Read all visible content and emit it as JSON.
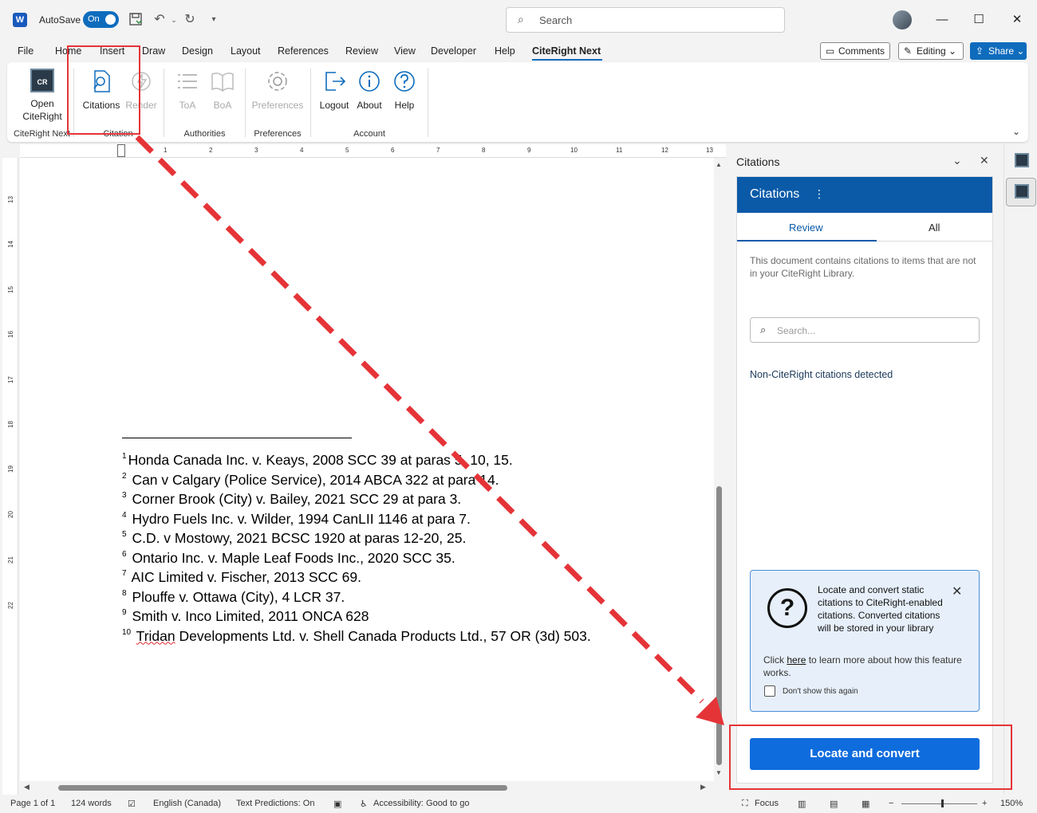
{
  "titlebar": {
    "app_letter": "W",
    "autosave_label": "AutoSave",
    "autosave_state": "On",
    "search_placeholder": "Search"
  },
  "ribbon_tabs": [
    "File",
    "Home",
    "Insert",
    "Draw",
    "Design",
    "Layout",
    "References",
    "Review",
    "View",
    "Developer",
    "Help",
    "CiteRight Next"
  ],
  "active_tab": "CiteRight Next",
  "ribbon_buttons": {
    "comments": "Comments",
    "editing": "Editing",
    "share": "Share"
  },
  "ribbon": {
    "open_citeright": "Open CiteRight",
    "logo_text": "CR",
    "citations": "Citations",
    "render": "Render",
    "toa": "ToA",
    "boa": "BoA",
    "preferences": "Preferences",
    "logout": "Logout",
    "about": "About",
    "help": "Help",
    "groups": {
      "citeright_next": "CiteRight Next",
      "citation": "Citation",
      "authorities": "Authorities",
      "preferences": "Preferences",
      "account": "Account"
    }
  },
  "ruler": {
    "horizontal": [
      "1",
      "2",
      "3",
      "4",
      "5",
      "6",
      "7",
      "8",
      "9",
      "10",
      "11",
      "12",
      "13"
    ],
    "vertical": [
      "13",
      "14",
      "15",
      "16",
      "17",
      "18",
      "19",
      "20",
      "21",
      "22"
    ]
  },
  "footnotes": [
    {
      "num": "1",
      "text": "Honda Canada Inc. v. Keays, 2008 SCC 39 at paras 5, 10, 15."
    },
    {
      "num": "2",
      "text": "Can v Calgary (Police Service), 2014 ABCA 322 at para 14."
    },
    {
      "num": "3",
      "text": "Corner Brook (City) v. Bailey, 2021 SCC 29 at para 3."
    },
    {
      "num": "4",
      "text": "Hydro Fuels Inc. v. Wilder, 1994 CanLII 1146 at para 7."
    },
    {
      "num": "5",
      "text": "C.D. v Mostowy, 2021 BCSC 1920 at paras 12-20, 25."
    },
    {
      "num": "6",
      "text": "Ontario Inc. v. Maple Leaf Foods Inc., 2020 SCC 35."
    },
    {
      "num": "7",
      "text": "AIC Limited v. Fischer, 2013 SCC 69."
    },
    {
      "num": "8",
      "text": "Plouffe v. Ottawa (City), 4 LCR 37."
    },
    {
      "num": "9",
      "text": "Smith v. Inco Limited, 2011 ONCA 628"
    },
    {
      "num": "10",
      "squiggle": "Tridan",
      "text": " Developments Ltd. v. Shell Canada Products Ltd., 57 OR (3d) 503."
    }
  ],
  "pane": {
    "title": "Citations",
    "header": "Citations",
    "header_menu": "⋮",
    "tab_review": "Review",
    "tab_all": "All",
    "message": "This document contains citations to items that are not in your CiteRight Library.",
    "search_placeholder": "Search...",
    "detected": "Non-CiteRight citations detected",
    "info": {
      "text": "Locate and convert static citations to CiteRight-enabled citations. Converted citations will be stored in your library",
      "click_prefix": "Click ",
      "click_link": "here",
      "click_suffix": " to learn more about how this feature works.",
      "checkbox_label": "Don't show this again"
    },
    "button": "Locate and convert"
  },
  "statusbar": {
    "page": "Page 1 of 1",
    "words": "124 words",
    "language": "English (Canada)",
    "predictions": "Text Predictions: On",
    "accessibility": "Accessibility: Good to go",
    "focus": "Focus",
    "zoom": "150%",
    "zoom_minus": "−",
    "zoom_plus": "+"
  },
  "colors": {
    "accent": "#0f6cbd",
    "annotation": "#e53438",
    "pane_header": "#0a5aa8"
  }
}
